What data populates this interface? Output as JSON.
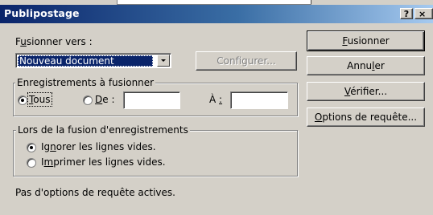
{
  "window": {
    "title": "Publipostage",
    "help_glyph": "?",
    "close_glyph": "×"
  },
  "merge_to": {
    "label_pre": "F",
    "label_u": "u",
    "label_post": "sionner vers :",
    "value": "Nouveau document",
    "configure_label": "Configurer..."
  },
  "records": {
    "legend": "Enregistrements à fusionner",
    "all_u": "T",
    "all_rest": "ous",
    "from_u": "D",
    "from_rest": "e :",
    "from_value": "",
    "to_pre": "À ",
    "to_u": ":",
    "to_value": "",
    "selected": "all"
  },
  "blank_lines": {
    "legend": "Lors de la fusion d'enregistrements",
    "ignore_pre": "Ig",
    "ignore_u": "n",
    "ignore_post": "orer les lignes vides.",
    "print_pre": "I",
    "print_u": "m",
    "print_post": "primer les lignes vides.",
    "selected": "ignore"
  },
  "status": {
    "text": "Pas d'options de requête actives."
  },
  "buttons": {
    "merge_u": "F",
    "merge_rest": "usionner",
    "cancel_pre": "Annu",
    "cancel_u": "l",
    "cancel_post": "er",
    "check_u": "V",
    "check_rest": "érifier...",
    "query_u": "O",
    "query_rest": "ptions de requête..."
  }
}
